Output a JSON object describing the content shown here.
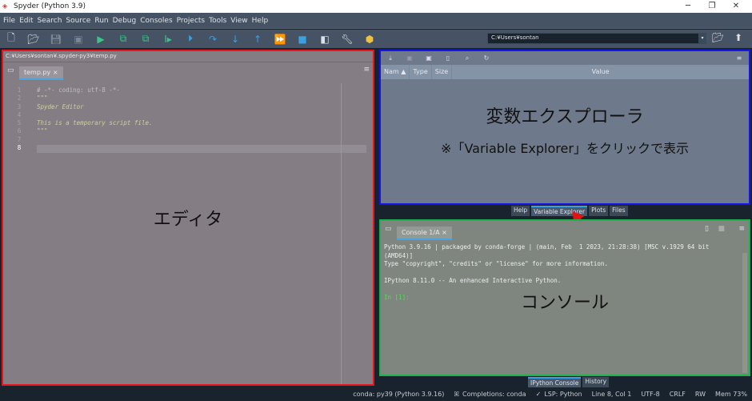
{
  "window": {
    "title": "Spyder (Python 3.9)"
  },
  "menu": [
    "File",
    "Edit",
    "Search",
    "Source",
    "Run",
    "Debug",
    "Consoles",
    "Projects",
    "Tools",
    "View",
    "Help"
  ],
  "toolbar": {
    "working_dir": "C:¥Users¥sontan"
  },
  "editor": {
    "path": "C:¥Users¥sontan¥.spyder-py3¥temp.py",
    "tab": "temp.py",
    "line_numbers": [
      "1",
      "2",
      "3",
      "4",
      "5",
      "6",
      "7",
      "8"
    ],
    "lines": [
      "# -*- coding: utf-8 -*-",
      "\"\"\"",
      "Spyder Editor",
      "",
      "This is a temporary script file.",
      "\"\"\"",
      "",
      ""
    ],
    "annotation": "エディタ"
  },
  "variable_explorer": {
    "columns": [
      "Nam",
      "Type",
      "Size",
      "Value"
    ],
    "annotation_title": "変数エクスプローラ",
    "annotation_note": "※「Variable Explorer」をクリックで表示"
  },
  "pane_tabs": [
    "Help",
    "Variable Explorer",
    "Plots",
    "Files"
  ],
  "console": {
    "tab": "Console 1/A",
    "output": [
      "Python 3.9.16 | packaged by conda-forge | (main, Feb  1 2023, 21:28:38) [MSC v.1929 64 bit",
      "(AMD64)]",
      "Type \"copyright\", \"credits\" or \"license\" for more information.",
      "",
      "IPython 8.11.0 -- An enhanced Interactive Python.",
      ""
    ],
    "prompt": "In [1]:",
    "annotation": "コンソール"
  },
  "console_tabs": [
    "IPython Console",
    "History"
  ],
  "status": {
    "env": "conda: py39 (Python 3.9.16)",
    "completions": "Completions: conda",
    "lsp": "LSP: Python",
    "position": "Line 8, Col 1",
    "encoding": "UTF-8",
    "eol": "CRLF",
    "mode": "RW",
    "mem": "Mem 73%"
  }
}
